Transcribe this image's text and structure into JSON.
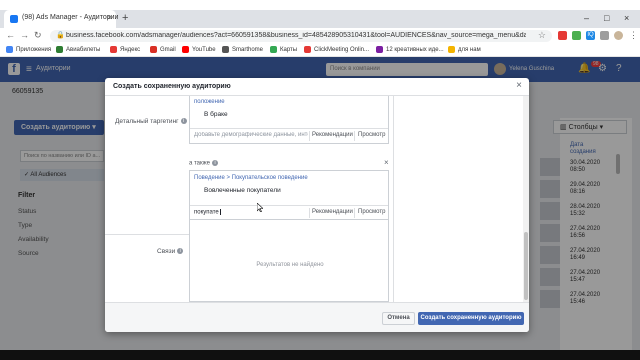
{
  "browser": {
    "tab_title": "(98) Ads Manager - Аудитории",
    "tab_close": "×",
    "new_tab": "+",
    "url": "business.facebook.com/adsmanager/audiences?act=660591358&business_id=485428905310431&tool=AUDIENCES&nav_source=mega_menu&date=2010-02-1..."
  },
  "bookmarks": [
    {
      "label": "Приложения",
      "color": "#4285f4"
    },
    {
      "label": "Авиабилеты",
      "color": "#2e7d32"
    },
    {
      "label": "Яндекс",
      "color": "#e53935"
    },
    {
      "label": "Gmail",
      "color": "#d93025"
    },
    {
      "label": "YouTube",
      "color": "#ff0000"
    },
    {
      "label": "Smarthome",
      "color": "#555555"
    },
    {
      "label": "Карты",
      "color": "#34a853"
    },
    {
      "label": "ClickMeeting Onlin...",
      "color": "#e53935"
    },
    {
      "label": "12 креативных иде...",
      "color": "#7b1fa2"
    },
    {
      "label": "для нам",
      "color": "#f4b400"
    }
  ],
  "fb_header": {
    "logo": "f",
    "menu_icon": "≡",
    "title": "Аудитории",
    "search_placeholder": "Поиск в компании",
    "user_name": "Yelena Guschina",
    "badge": "98"
  },
  "page": {
    "account_id": "66059135",
    "create_audience": "Создать аудиторию",
    "search_placeholder": "Поиск по названию или ID а...",
    "all_audiences": "All Audiences",
    "filter_title": "Filter",
    "filters": [
      "Status",
      "Type",
      "Availability",
      "Source"
    ],
    "columns_button": "Столбцы",
    "date_header": [
      "Дата",
      "создания"
    ],
    "dates": [
      [
        "30.04.2020",
        "08:50"
      ],
      [
        "29.04.2020",
        "08:16"
      ],
      [
        "28.04.2020",
        "15:32"
      ],
      [
        "27.04.2020",
        "16:56"
      ],
      [
        "27.04.2020",
        "16:49"
      ],
      [
        "27.04.2020",
        "15:47"
      ],
      [
        "27.04.2020",
        "15:46"
      ]
    ]
  },
  "modal": {
    "title": "Создать сохраненную аудиторию",
    "close": "×",
    "detailed_targeting_label": "Детальный таргетинг",
    "info_icon": "i",
    "block1": {
      "link": "положение",
      "selected": "В браке",
      "input_placeholder": "Добавьте демографические данные, инте...",
      "recommendations": "Рекомендации",
      "browse": "Просмотр"
    },
    "also_label": "а также",
    "block2": {
      "link": "Поведение > Покупательское поведение",
      "selected": "Вовлеченные покупатели",
      "input_value": "покупате",
      "recommendations": "Рекомендации",
      "browse": "Просмотр"
    },
    "connections_label": "Связи",
    "no_results": "Результатов не найдено",
    "cancel": "Отмена",
    "save": "Создать сохраненную аудиторию"
  }
}
